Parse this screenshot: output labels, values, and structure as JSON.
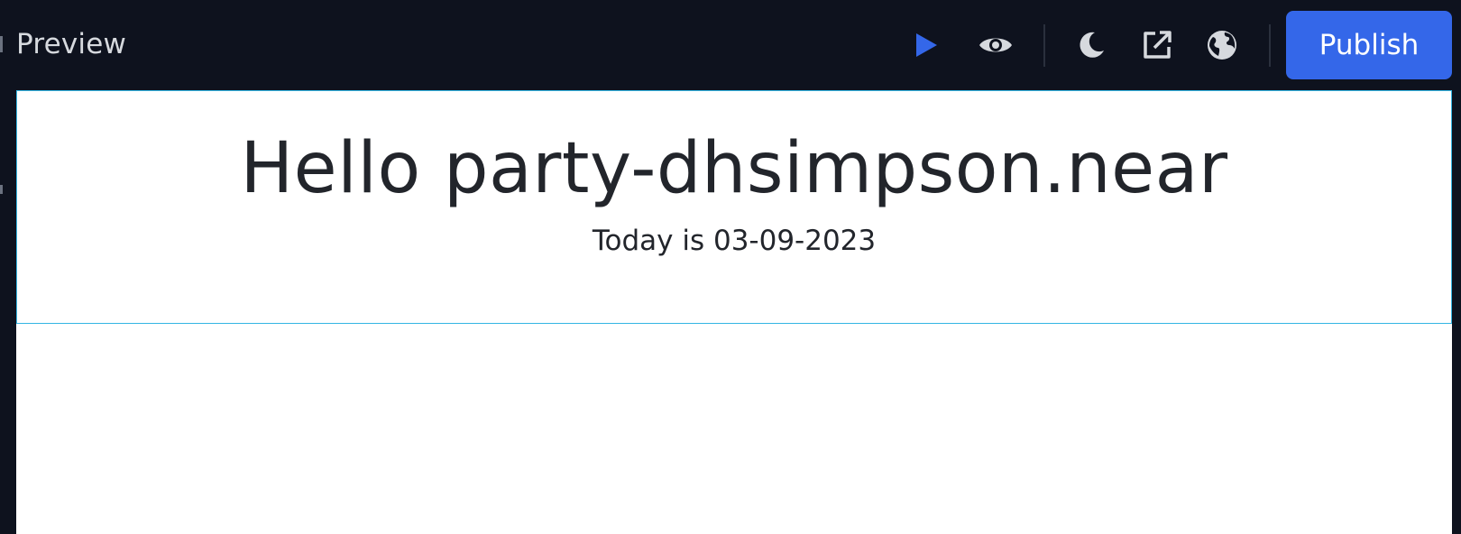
{
  "header": {
    "title": "Preview",
    "icons": {
      "run": "play-icon",
      "preview": "eye-icon",
      "theme": "moon-icon",
      "open_external": "external-link-icon",
      "web": "globe-icon"
    },
    "publish_label": "Publish"
  },
  "preview": {
    "greeting": "Hello party-dhsimpson.near",
    "date_text": "Today is 03-09-2023"
  },
  "colors": {
    "background": "#0e121e",
    "accent": "#3467e9",
    "icon": "#d6d9de",
    "play": "#3467e9",
    "widget_border": "#34b6e4"
  }
}
